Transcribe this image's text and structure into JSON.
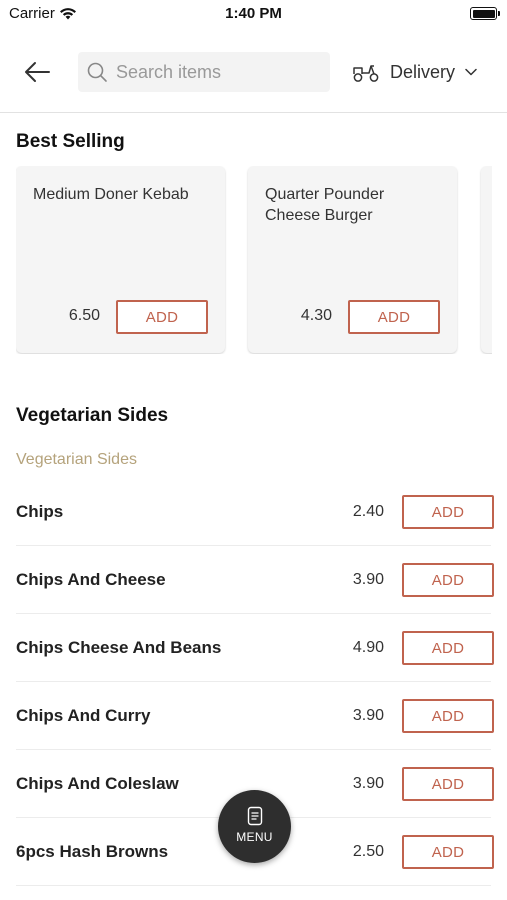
{
  "status": {
    "carrier": "Carrier",
    "time": "1:40 PM"
  },
  "header": {
    "search_placeholder": "Search items",
    "delivery_label": "Delivery"
  },
  "best_selling": {
    "title": "Best Selling",
    "items": [
      {
        "name": "Medium Doner Kebab",
        "price": "6.50",
        "add_label": "ADD"
      },
      {
        "name": "Quarter Pounder Cheese Burger",
        "price": "4.30",
        "add_label": "ADD"
      }
    ]
  },
  "vegetarian": {
    "title": "Vegetarian Sides",
    "subtitle": "Vegetarian Sides",
    "items": [
      {
        "name": "Chips",
        "price": "2.40",
        "add_label": "ADD"
      },
      {
        "name": "Chips And Cheese",
        "price": "3.90",
        "add_label": "ADD"
      },
      {
        "name": "Chips Cheese And Beans",
        "price": "4.90",
        "add_label": "ADD"
      },
      {
        "name": "Chips And Curry",
        "price": "3.90",
        "add_label": "ADD"
      },
      {
        "name": "Chips And Coleslaw",
        "price": "3.90",
        "add_label": "ADD"
      },
      {
        "name": "6pcs Hash Browns",
        "price": "2.50",
        "add_label": "ADD"
      }
    ]
  },
  "menu_fab": {
    "label": "MENU"
  },
  "colors": {
    "accent": "#c0634e",
    "subtitle": "#b5a37c",
    "fab": "#2e2e2e"
  },
  "icons": [
    "wifi-icon",
    "battery-icon",
    "back-arrow-icon",
    "search-icon",
    "scooter-icon",
    "chevron-down-icon",
    "menu-card-icon"
  ]
}
